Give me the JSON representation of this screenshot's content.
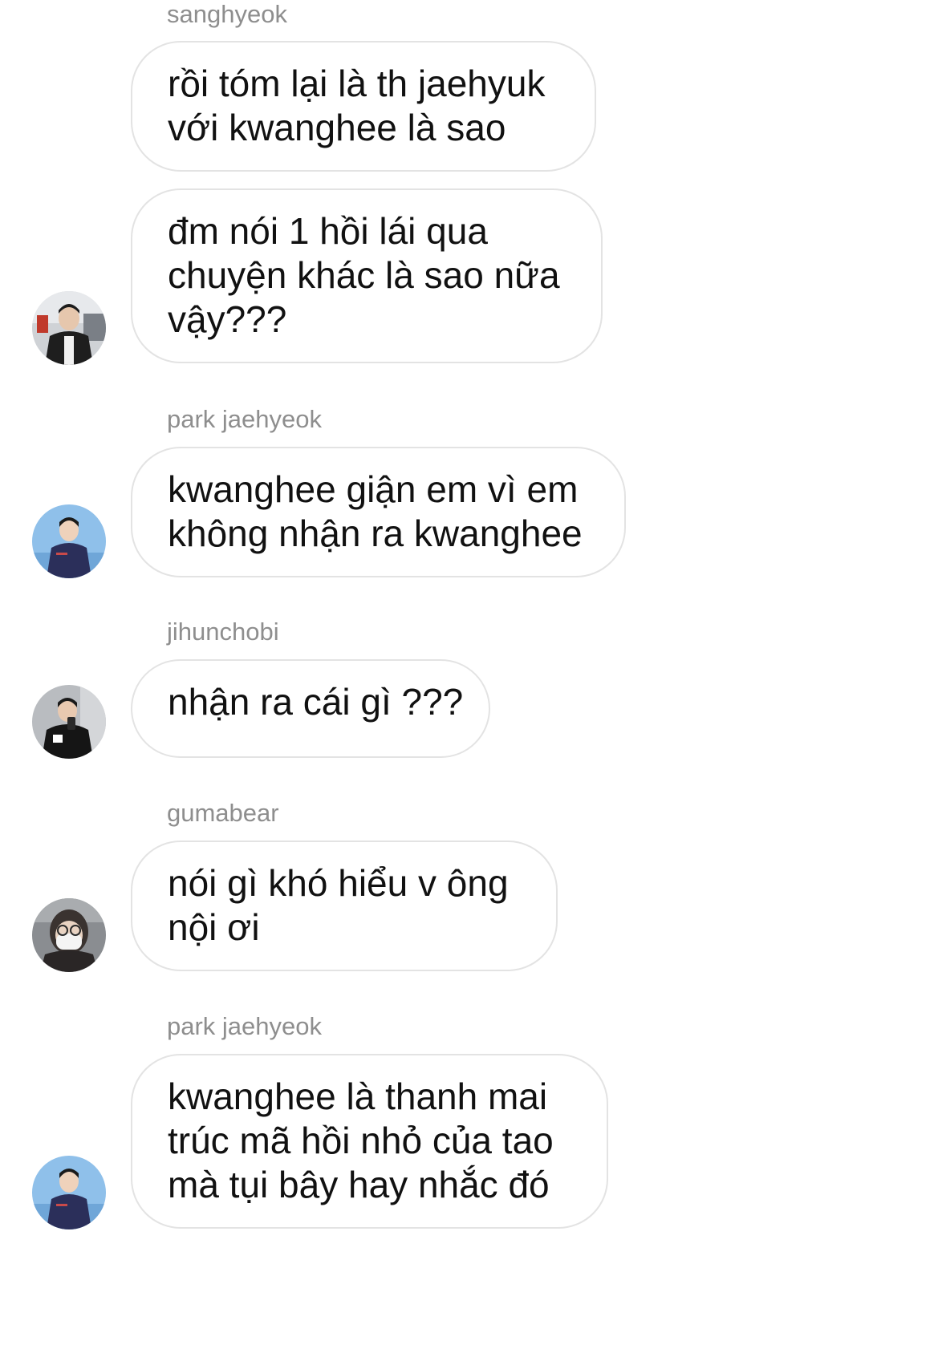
{
  "messages": [
    {
      "sender": "sanghyeok",
      "bubbles": [
        [
          "rồi tóm lại là th jaehyuk",
          "với kwanghee là sao"
        ],
        [
          "đm nói 1 hồi lái qua",
          "chuyện khác là sao nữa",
          "vậy???"
        ]
      ],
      "avatar_icon": "profile-photo-icon"
    },
    {
      "sender": "park jaehyeok",
      "bubbles": [
        [
          "kwanghee giận em vì em",
          "không nhận ra kwanghee"
        ]
      ],
      "avatar_icon": "profile-photo-icon"
    },
    {
      "sender": "jihunchobi",
      "bubbles": [
        [
          "nhận ra cái gì ???"
        ]
      ],
      "avatar_icon": "profile-photo-icon"
    },
    {
      "sender": "gumabear",
      "bubbles": [
        [
          "nói gì khó hiểu v ông",
          "nội ơi"
        ]
      ],
      "avatar_icon": "profile-photo-icon"
    },
    {
      "sender": "park jaehyeok",
      "bubbles": [
        [
          "kwanghee là thanh mai",
          "trúc mã hồi nhỏ của tao",
          "mà tụi bây hay nhắc đó"
        ]
      ],
      "avatar_icon": "profile-photo-icon"
    }
  ],
  "colors": {
    "background": "#ffffff",
    "bubble_border": "#e3e3e3",
    "sender_text": "#8e8e8e",
    "message_text": "#111111"
  }
}
